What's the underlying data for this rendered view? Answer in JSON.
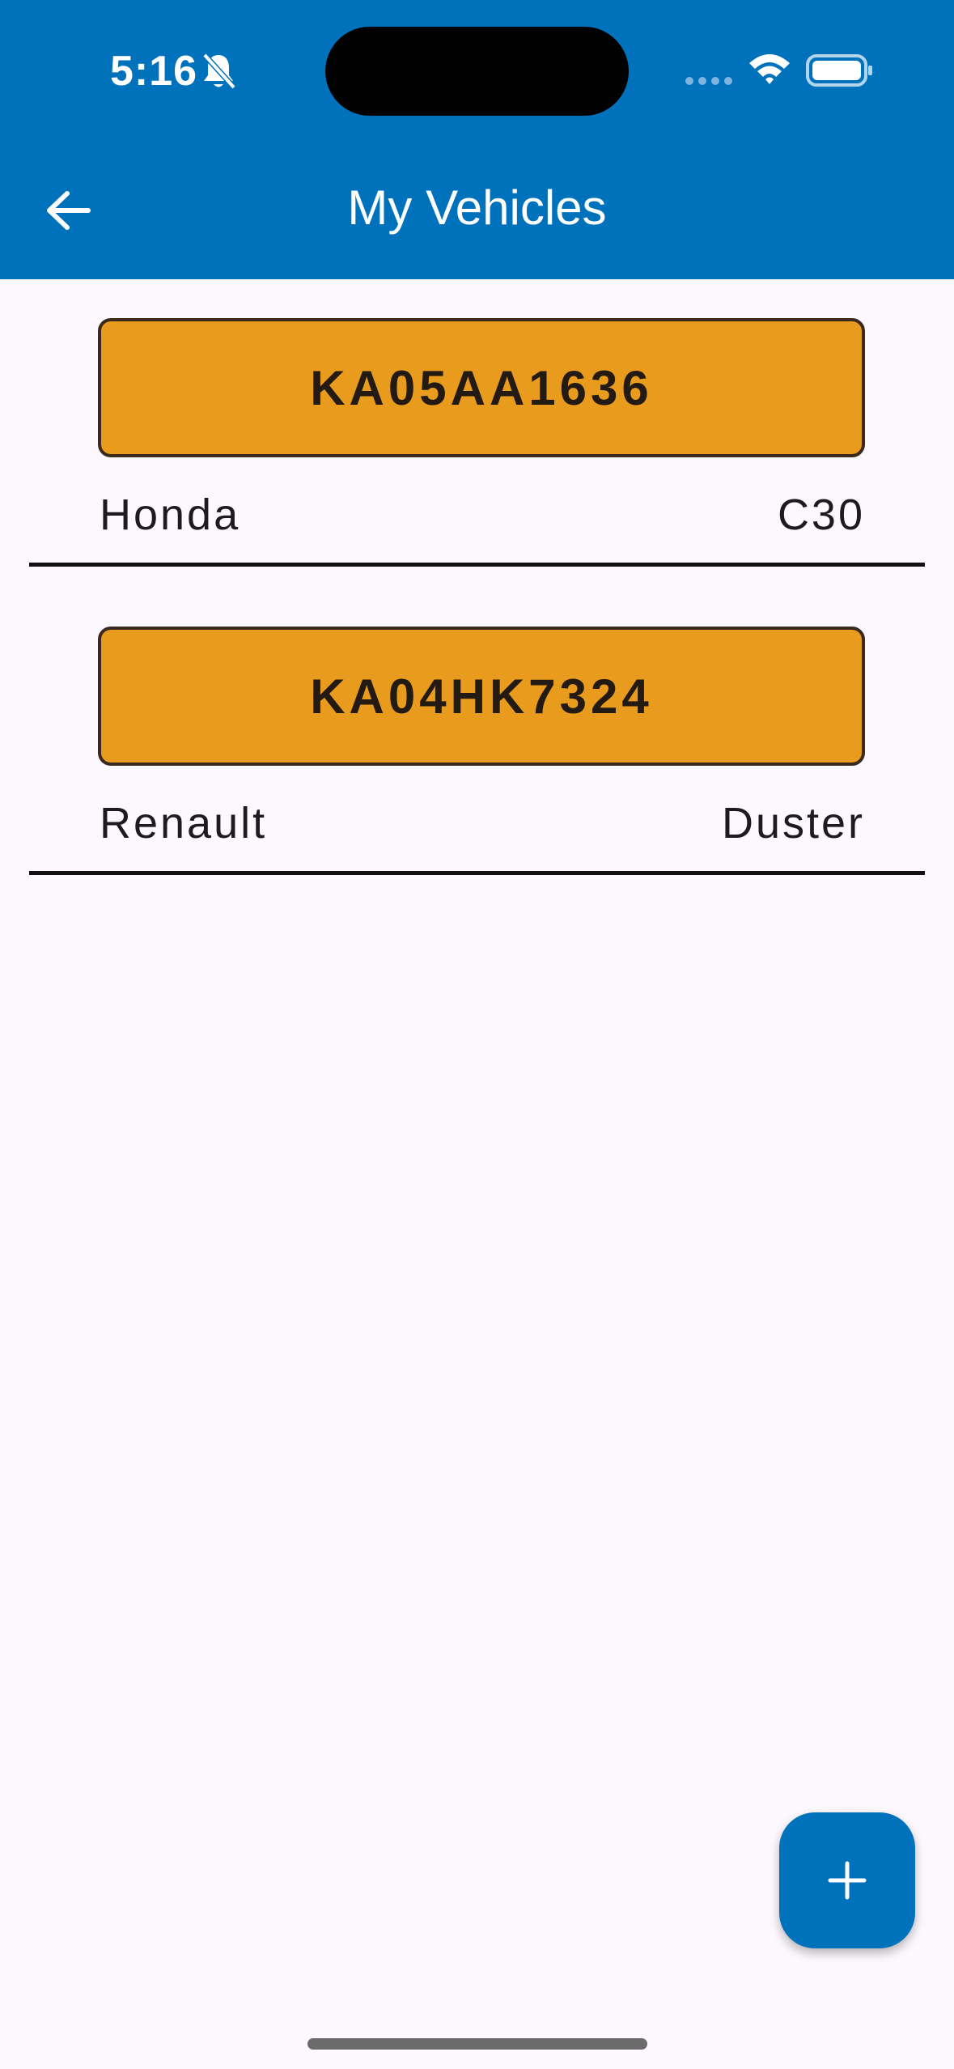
{
  "status_bar": {
    "time": "5:16"
  },
  "header": {
    "title": "My Vehicles",
    "background_color": "#0072bc"
  },
  "vehicles": [
    {
      "plate": "KA05AA1636",
      "make": "Honda",
      "model": "C30"
    },
    {
      "plate": "KA04HK7324",
      "make": "Renault",
      "model": "Duster"
    }
  ],
  "icons": {
    "back": "arrow-left-icon",
    "add": "plus-icon",
    "notifications": "bell-slash-icon",
    "wifi": "wifi-icon",
    "battery": "battery-icon"
  },
  "colors": {
    "accent": "#0072bc",
    "plate_fill": "#e89b1c",
    "plate_border": "#3a2a1e",
    "background": "#fdf8fd"
  }
}
